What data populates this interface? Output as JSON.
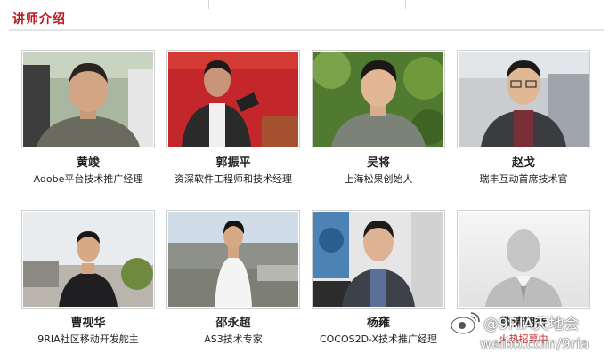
{
  "section": {
    "title": "讲师介绍"
  },
  "speakers": [
    {
      "name": "黄竣",
      "title": "Adobe平台技术推广经理"
    },
    {
      "name": "郭振平",
      "title": "资深软件工程师和技术经理"
    },
    {
      "name": "吴将",
      "title": "上海松果创始人"
    },
    {
      "name": "赵戈",
      "title": "瑞丰互动首席技术官"
    },
    {
      "name": "曹视华",
      "title": "9RIA社区移动开发舵主"
    },
    {
      "name": "邵永超",
      "title": "AS3技术专家"
    },
    {
      "name": "杨雍",
      "title": "COCOS2D-X技术推广经理"
    },
    {
      "name": "敬请期待",
      "title": "火热招募中"
    }
  ],
  "watermark": {
    "handle": "@9RIA天地会",
    "url": "weibo.com/9ria"
  },
  "colors": {
    "accent": "#b81c22",
    "recruit": "#c62a2a"
  }
}
